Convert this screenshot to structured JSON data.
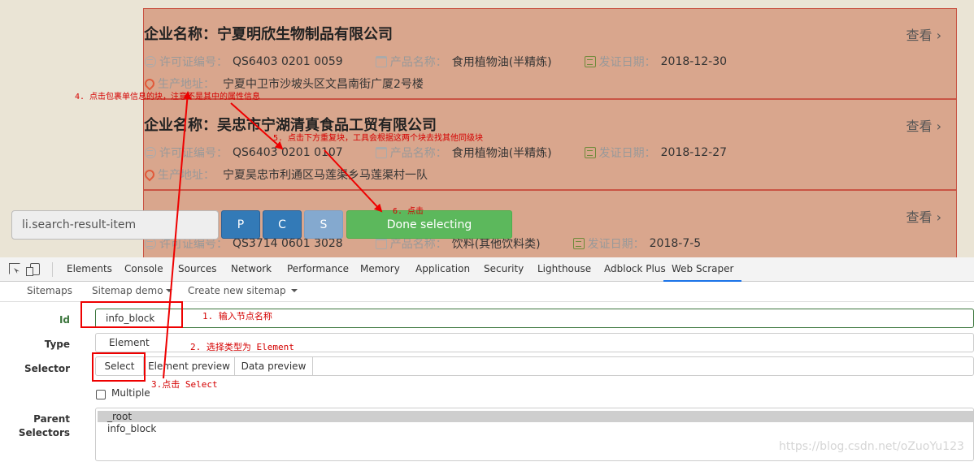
{
  "webpage": {
    "cards": [
      {
        "title": "企业名称：宁夏明欣生物制品有限公司",
        "view_label": "查看",
        "license_label": "许可证编号：",
        "license_value": "QS6403 0201 0059",
        "product_label": "产品名称：",
        "product_value": "食用植物油(半精炼)",
        "date_label": "发证日期：",
        "date_value": "2018-12-30",
        "address_label": "生产地址：",
        "address_value": "宁夏中卫市沙坡头区文昌南街广厦2号楼"
      },
      {
        "title": "企业名称：吴忠市宁湖清真食品工贸有限公司",
        "view_label": "查看",
        "license_label": "许可证编号：",
        "license_value": "QS6403 0201 0107",
        "product_label": "产品名称：",
        "product_value": "食用植物油(半精炼)",
        "date_label": "发证日期：",
        "date_value": "2018-12-27",
        "address_label": "生产地址：",
        "address_value": "宁夏吴忠市利通区马莲渠乡马莲渠村一队"
      },
      {
        "view_label": "查看",
        "license_label": "许可证编号：",
        "license_value": "QS3714 0601 3028",
        "product_label": "产品名称：",
        "product_value": "饮料(其他饮料类)",
        "date_label": "发证日期：",
        "date_value": "2018-7-5"
      }
    ]
  },
  "select_toolbar": {
    "selector_value": "li.search-result-item",
    "p_label": "P",
    "c_label": "C",
    "s_label": "S",
    "done_label": "Done selecting"
  },
  "devtools": {
    "tabs": [
      "Elements",
      "Console",
      "Sources",
      "Network",
      "Performance",
      "Memory",
      "Application",
      "Security",
      "Lighthouse",
      "Adblock Plus",
      "Web Scraper"
    ],
    "active_tab": "Web Scraper"
  },
  "scraper_nav": {
    "sitemaps": "Sitemaps",
    "sitemap_demo": "Sitemap demo",
    "create_new": "Create new sitemap"
  },
  "form": {
    "id_label": "Id",
    "id_value": "info_block",
    "type_label": "Type",
    "type_value": "Element",
    "selector_label": "Selector",
    "select_button": "Select",
    "element_preview": "Element preview",
    "data_preview": "Data preview",
    "multiple_label": "Multiple",
    "multiple_checked": false,
    "parent_label_1": "Parent",
    "parent_label_2": "Selectors",
    "parent_options": [
      "_root",
      "info_block"
    ]
  },
  "annotations": {
    "step1": "1. 输入节点名称",
    "step2": "2. 选择类型为 Element",
    "step3": "3.点击 Select",
    "step4": "4. 点击包裹单信息的块，注意不是其中的属性信息",
    "step5": "5. 点击下方重复块，工具会根据这两个块去找其他同级块",
    "step6": "6. 点击",
    "color": "#d40000"
  },
  "watermark": "https://blog.csdn.net/oZuoYu123",
  "colors": {
    "page_bg": "#eae4d5",
    "card_bg": "#d9a68d",
    "card_border": "#c95444",
    "primary_button": "#337ab7",
    "done_button": "#5cb85c",
    "valid_green": "#3c763d"
  }
}
